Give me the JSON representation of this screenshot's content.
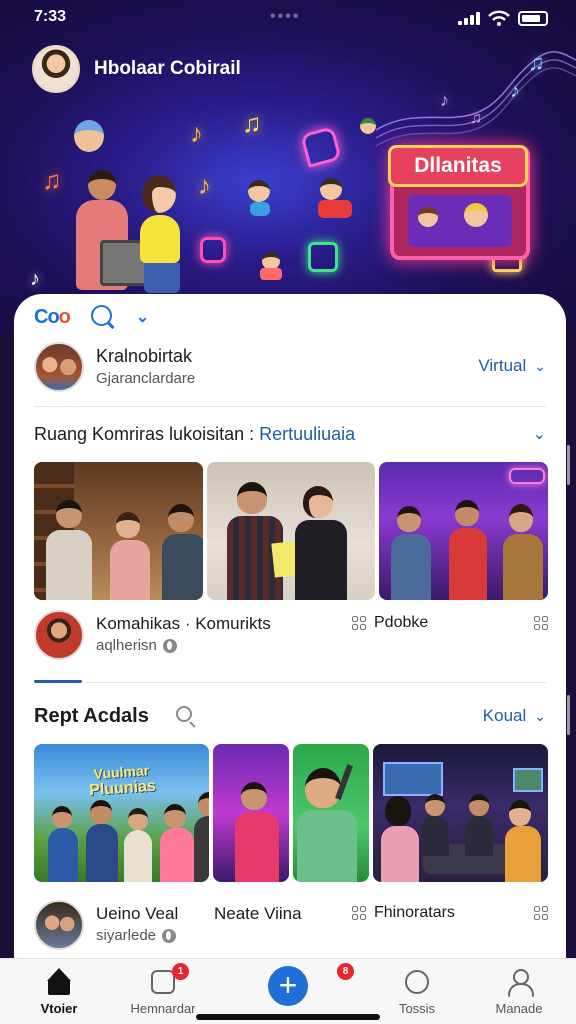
{
  "status_bar": {
    "time": "7:33"
  },
  "profile": {
    "name": "Hbolaar Cobirail"
  },
  "banner": {
    "booth_sign": "Dllanitas"
  },
  "card_header": {
    "logo_a": "Co",
    "logo_b": "o"
  },
  "user": {
    "name": "Kralnobirtak",
    "subtitle": "Gjaranclardare",
    "dropdown": "Virtual"
  },
  "section1": {
    "title_main": "Ruang Komriras lukoisitan : ",
    "title_highlight": "Rertuuliuaia",
    "meta_title": "Komahikas · Komurikts",
    "meta_sub": "aqlherisn",
    "meta_mid": "Pdobke"
  },
  "section2": {
    "title": "Rept Acdals",
    "dropdown": "Koual",
    "poster_text_1": "Vuulmar",
    "poster_text_2": "Pluunias",
    "meta_title": "Ueino Veal",
    "meta_title_2": "Neate Viina",
    "meta_sub": "siyarlede",
    "meta_mid": "Fhinoratars"
  },
  "bottom_nav": {
    "items": [
      {
        "label": "Vtoier",
        "icon": "home-icon",
        "active": true
      },
      {
        "label": "Hemnardar",
        "icon": "gallery-icon",
        "badge": "1"
      },
      {
        "label": "",
        "icon": "plus-icon",
        "badge": "8"
      },
      {
        "label": "Tossis",
        "icon": "clock-icon"
      },
      {
        "label": "Manade",
        "icon": "user-icon"
      }
    ]
  },
  "colors": {
    "accent": "#1f5ea8",
    "fab": "#1f6fd6",
    "badge": "#e8262c",
    "hero": "#1d0f55"
  }
}
